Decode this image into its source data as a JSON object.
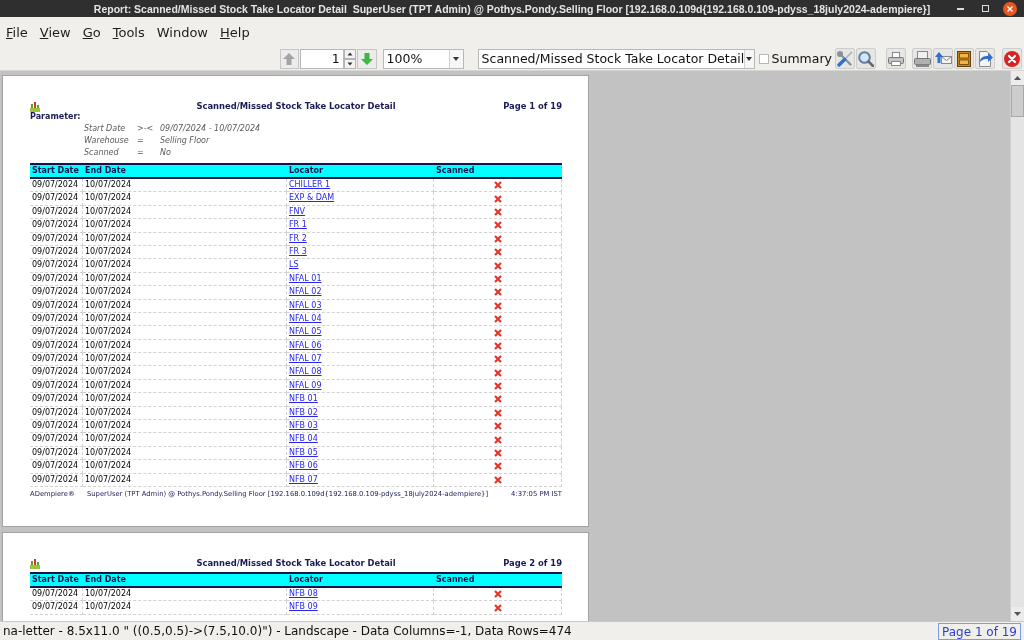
{
  "window": {
    "title": "Report: Scanned/Missed Stock Take Locator Detail  SuperUser (TPT Admin) @ Pothys.Pondy.Selling Floor [192.168.0.109d{192.168.0.109-pdyss_18july2024-adempiere}]"
  },
  "menu": [
    {
      "label": "File",
      "mnemonic": true
    },
    {
      "label": "View",
      "mnemonic": true
    },
    {
      "label": "Go",
      "mnemonic": true
    },
    {
      "label": "Tools",
      "mnemonic": true
    },
    {
      "label": "Window",
      "mnemonic": false
    },
    {
      "label": "Help",
      "mnemonic": true
    }
  ],
  "toolbar": {
    "previous_page": {
      "disabled": true
    },
    "page_number": "1",
    "next_page": {
      "disabled": false
    },
    "zoom": "100%",
    "report": "Scanned/Missed Stock Take Locator Detail",
    "summary": {
      "label": "Summary",
      "checked": false
    }
  },
  "pages": [
    {
      "title": "Scanned/Missed Stock Take Locator Detail",
      "page_label": "Page 1 of 19",
      "parameter_heading": "Parameter:",
      "parameters": [
        {
          "name": "Start Date",
          "operator": ">-<",
          "value": "09/07/2024 - 10/07/2024"
        },
        {
          "name": "Warehouse",
          "operator": "=",
          "value": "Selling Floor"
        },
        {
          "name": "Scanned",
          "operator": "=",
          "value": "No"
        }
      ],
      "columns": [
        "Start Date",
        "End Date",
        "Locator",
        "Scanned"
      ],
      "rows": [
        {
          "start_date": "09/07/2024",
          "end_date": "10/07/2024",
          "locator": "CHILLER 1",
          "scanned": false
        },
        {
          "start_date": "09/07/2024",
          "end_date": "10/07/2024",
          "locator": "EXP & DAM",
          "scanned": false
        },
        {
          "start_date": "09/07/2024",
          "end_date": "10/07/2024",
          "locator": "FNV",
          "scanned": false
        },
        {
          "start_date": "09/07/2024",
          "end_date": "10/07/2024",
          "locator": "FR 1",
          "scanned": false
        },
        {
          "start_date": "09/07/2024",
          "end_date": "10/07/2024",
          "locator": "FR 2",
          "scanned": false
        },
        {
          "start_date": "09/07/2024",
          "end_date": "10/07/2024",
          "locator": "FR 3",
          "scanned": false
        },
        {
          "start_date": "09/07/2024",
          "end_date": "10/07/2024",
          "locator": "LS",
          "scanned": false
        },
        {
          "start_date": "09/07/2024",
          "end_date": "10/07/2024",
          "locator": "NFAL 01",
          "scanned": false
        },
        {
          "start_date": "09/07/2024",
          "end_date": "10/07/2024",
          "locator": "NFAL 02",
          "scanned": false
        },
        {
          "start_date": "09/07/2024",
          "end_date": "10/07/2024",
          "locator": "NFAL 03",
          "scanned": false
        },
        {
          "start_date": "09/07/2024",
          "end_date": "10/07/2024",
          "locator": "NFAL 04",
          "scanned": false
        },
        {
          "start_date": "09/07/2024",
          "end_date": "10/07/2024",
          "locator": "NFAL 05",
          "scanned": false
        },
        {
          "start_date": "09/07/2024",
          "end_date": "10/07/2024",
          "locator": "NFAL 06",
          "scanned": false
        },
        {
          "start_date": "09/07/2024",
          "end_date": "10/07/2024",
          "locator": "NFAL 07",
          "scanned": false
        },
        {
          "start_date": "09/07/2024",
          "end_date": "10/07/2024",
          "locator": "NFAL 08",
          "scanned": false
        },
        {
          "start_date": "09/07/2024",
          "end_date": "10/07/2024",
          "locator": "NFAL 09",
          "scanned": false
        },
        {
          "start_date": "09/07/2024",
          "end_date": "10/07/2024",
          "locator": "NFB 01",
          "scanned": false
        },
        {
          "start_date": "09/07/2024",
          "end_date": "10/07/2024",
          "locator": "NFB 02",
          "scanned": false
        },
        {
          "start_date": "09/07/2024",
          "end_date": "10/07/2024",
          "locator": "NFB 03",
          "scanned": false
        },
        {
          "start_date": "09/07/2024",
          "end_date": "10/07/2024",
          "locator": "NFB 04",
          "scanned": false
        },
        {
          "start_date": "09/07/2024",
          "end_date": "10/07/2024",
          "locator": "NFB 05",
          "scanned": false
        },
        {
          "start_date": "09/07/2024",
          "end_date": "10/07/2024",
          "locator": "NFB 06",
          "scanned": false
        },
        {
          "start_date": "09/07/2024",
          "end_date": "10/07/2024",
          "locator": "NFB 07",
          "scanned": false
        }
      ],
      "footer": {
        "brand": "ADempiere®",
        "session": "SuperUser (TPT Admin) @ Pothys.Pondy.Selling Floor [192.168.0.109d{192.168.0.109-pdyss_18july2024-adempiere}]",
        "printed": "4:37:05 PM IST"
      }
    },
    {
      "title": "Scanned/Missed Stock Take Locator Detail",
      "page_label": "Page 2 of 19",
      "columns": [
        "Start Date",
        "End Date",
        "Locator",
        "Scanned"
      ],
      "rows": [
        {
          "start_date": "09/07/2024",
          "end_date": "10/07/2024",
          "locator": "NFB 08",
          "scanned": false
        },
        {
          "start_date": "09/07/2024",
          "end_date": "10/07/2024",
          "locator": "NFB 09",
          "scanned": false
        }
      ]
    }
  ],
  "status_bar": {
    "text": "na-letter - 8.5x11.0 \" ((0.5,0.5)->(7.5,10.0)\") - Landscape - Data Columns=-1, Data Rows=474",
    "page": "Page 1 of 19"
  }
}
